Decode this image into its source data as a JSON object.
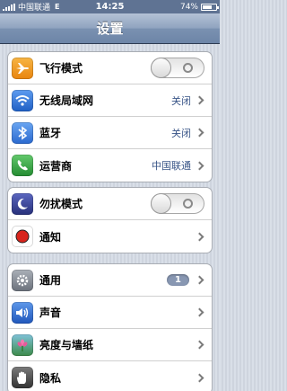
{
  "status_bar": {
    "carrier": "中国联通",
    "network": "E",
    "time": "14:25",
    "battery_percent": "74%",
    "battery_level": 0.74
  },
  "nav": {
    "title": "设置"
  },
  "groups": [
    {
      "rows": [
        {
          "label": "飞行模式",
          "icon": "airplane-icon",
          "icon_color": "#f29a1d",
          "control": "toggle",
          "on": false
        },
        {
          "label": "无线局域网",
          "icon": "wifi-icon",
          "icon_color": "#2d74d8",
          "value": "关闭"
        },
        {
          "label": "蓝牙",
          "icon": "bluetooth-icon",
          "icon_color": "#3c7fd8",
          "value": "关闭"
        },
        {
          "label": "运营商",
          "icon": "phone-icon",
          "icon_color": "#35a847",
          "value": "中国联通"
        }
      ]
    },
    {
      "rows": [
        {
          "label": "勿扰模式",
          "icon": "moon-icon",
          "icon_color": "#3b4aa0",
          "control": "toggle",
          "on": false
        },
        {
          "label": "通知",
          "icon": "notification-icon",
          "icon_color": "#d8241c"
        }
      ]
    },
    {
      "rows": [
        {
          "label": "通用",
          "icon": "gear-icon",
          "icon_color": "#8e939b",
          "badge": "1"
        },
        {
          "label": "声音",
          "icon": "speaker-icon",
          "icon_color": "#2f6fd0"
        },
        {
          "label": "亮度与墙纸",
          "icon": "flower-icon",
          "icon_color": "#4a9a54"
        },
        {
          "label": "隐私",
          "icon": "hand-icon",
          "icon_color": "#4f4f4f"
        }
      ]
    }
  ]
}
